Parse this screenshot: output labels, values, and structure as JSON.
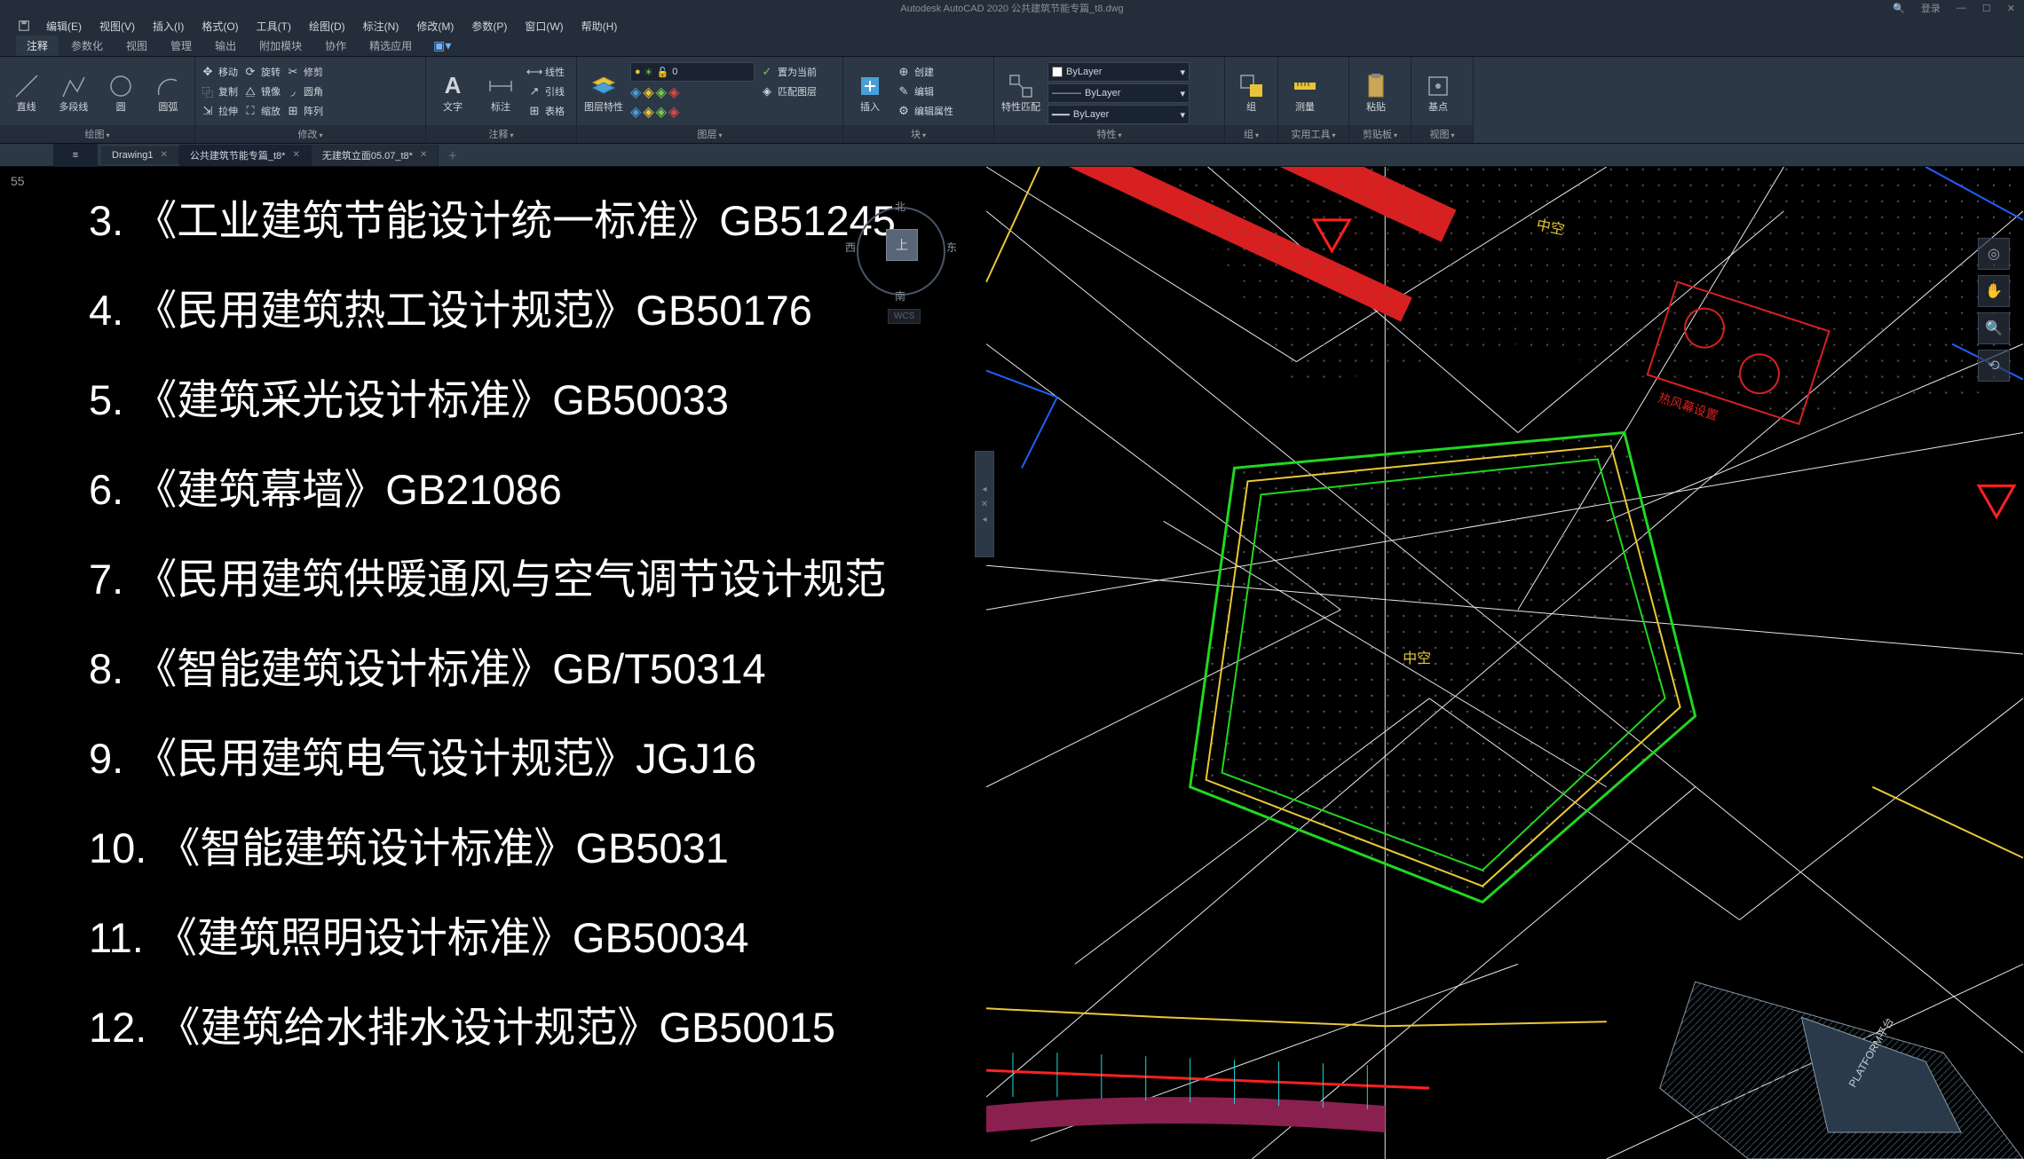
{
  "app": {
    "title": "Autodesk AutoCAD 2020   公共建筑节能专篇_t8.dwg",
    "login": "登录"
  },
  "menubar": [
    "编辑(E)",
    "视图(V)",
    "插入(I)",
    "格式(O)",
    "工具(T)",
    "绘图(D)",
    "标注(N)",
    "修改(M)",
    "参数(P)",
    "窗口(W)",
    "帮助(H)"
  ],
  "ribbontabs": [
    "注释",
    "参数化",
    "视图",
    "管理",
    "输出",
    "附加模块",
    "协作",
    "精选应用"
  ],
  "panels": {
    "draw": {
      "label": "绘图",
      "line": "直线",
      "polyline": "多段线",
      "circle": "圆",
      "arc": "圆弧"
    },
    "modify": {
      "label": "修改",
      "move": "移动",
      "rotate": "旋转",
      "trim": "修剪",
      "copy": "复制",
      "mirror": "镜像",
      "fillet": "圆角",
      "stretch": "拉伸",
      "scale": "缩放",
      "array": "阵列"
    },
    "annot": {
      "label": "注释",
      "text": "文字",
      "dim": "标注",
      "linear": "线性",
      "leader": "引线",
      "table": "表格"
    },
    "layers": {
      "label": "图层",
      "props": "图层特性",
      "dd_value": "0",
      "setcur": "置为当前",
      "match": "匹配图层"
    },
    "block": {
      "label": "块",
      "insert": "插入",
      "create": "创建",
      "edit": "编辑",
      "attr": "编辑属性"
    },
    "props": {
      "label": "特性",
      "match": "特性匹配",
      "bylayer": "ByLayer"
    },
    "group": {
      "label": "组",
      "group": "组"
    },
    "util": {
      "label": "实用工具",
      "measure": "测量"
    },
    "clip": {
      "label": "剪贴板",
      "paste": "粘贴"
    },
    "view": {
      "label": "视图",
      "base": "基点"
    }
  },
  "doctabs": [
    {
      "name": "Drawing1",
      "active": false
    },
    {
      "name": "公共建筑节能专篇_t8*",
      "active": true
    },
    {
      "name": "无建筑立面05.07_t8*",
      "active": false
    }
  ],
  "viewcube": {
    "top": "上",
    "n": "北",
    "s": "南",
    "e": "东",
    "w": "西",
    "wcs": "WCS"
  },
  "coord": "55",
  "textlines": [
    "3. 《工业建筑节能设计统一标准》GB51245",
    "4. 《民用建筑热工设计规范》GB50176",
    "5. 《建筑采光设计标准》GB50033",
    "6. 《建筑幕墙》GB21086",
    "7. 《民用建筑供暖通风与空气调节设计规范",
    "8. 《智能建筑设计标准》GB/T50314",
    "9. 《民用建筑电气设计规范》JGJ16",
    "10. 《智能建筑设计标准》GB5031",
    "11. 《建筑照明设计标准》GB50034",
    "12. 《建筑给水排水设计规范》GB50015"
  ],
  "drawing": {
    "label_center": "中空",
    "label_top": "中空",
    "label_red": "热风幕设置",
    "label_platform": "PLATFORM平台"
  }
}
